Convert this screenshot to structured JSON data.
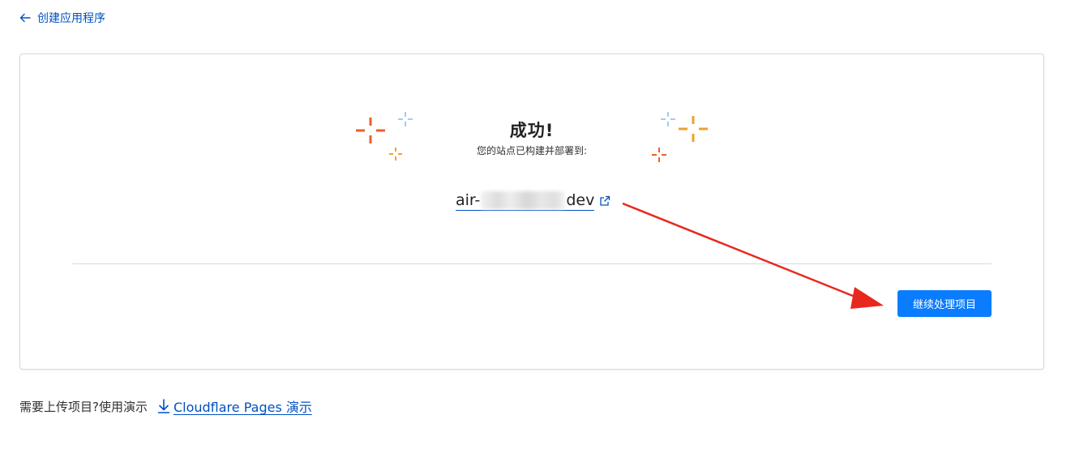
{
  "header": {
    "back_label": "创建应用程序",
    "back_icon": "arrow-left-icon"
  },
  "success": {
    "title": "成功!",
    "subtitle": "您的站点已构建并部署到:",
    "url_prefix": "air-",
    "url_suffix": "dev",
    "external_icon": "external-link-icon"
  },
  "actions": {
    "continue_label": "继续处理项目"
  },
  "footer": {
    "prompt": "需要上传项目?使用演示",
    "link_label": "Cloudflare Pages 演示",
    "link_icon": "download-icon"
  },
  "colors": {
    "accent": "#0a7cff",
    "link": "#0051c3",
    "sparkle_red": "#e8612c",
    "sparkle_orange": "#f0a030",
    "sparkle_blue": "#a9c8f0",
    "annotation_arrow": "#e8281e"
  }
}
